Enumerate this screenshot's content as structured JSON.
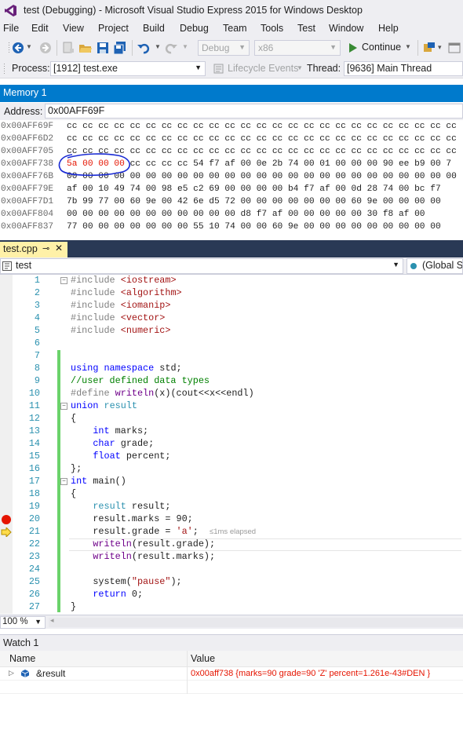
{
  "window": {
    "title": "test (Debugging) - Microsoft Visual Studio Express 2015 for Windows Desktop"
  },
  "menu": [
    "File",
    "Edit",
    "View",
    "Project",
    "Build",
    "Debug",
    "Team",
    "Tools",
    "Test",
    "Window",
    "Help"
  ],
  "toolbar": {
    "config": "Debug",
    "platform": "x86",
    "continue_label": "Continue"
  },
  "toolbar2": {
    "process_label": "Process:",
    "process_value": "[1912] test.exe",
    "lifecycle_label": "Lifecycle Events",
    "thread_label": "Thread:",
    "thread_value": "[9636] Main Thread"
  },
  "memory": {
    "tab_title": "Memory 1",
    "address_label": "Address:",
    "address_value": "0x00AFF69F",
    "rows": [
      {
        "addr": "0x00AFF69F",
        "bytes": "cc cc cc cc cc cc cc cc cc cc cc cc cc cc cc cc cc cc cc cc cc cc cc cc cc"
      },
      {
        "addr": "0x00AFF6D2",
        "bytes": "cc cc cc cc cc cc cc cc cc cc cc cc cc cc cc cc cc cc cc cc cc cc cc cc cc"
      },
      {
        "addr": "0x00AFF705",
        "bytes": "cc cc cc cc cc cc cc cc cc cc cc cc cc cc cc cc cc cc cc cc cc cc cc cc cc"
      },
      {
        "addr": "0x00AFF738",
        "changed": "5a 00 00 00",
        "bytes": " cc cc cc cc 54 f7 af 00 0e 2b 74 00 01 00 00 00 90 ee b9 00 7"
      },
      {
        "addr": "0x00AFF76B",
        "bytes": "00 00 00 00 00 00 00 00 00 00 00 00 00 00 00 00 00 00 00 00 00 00 00 00 00"
      },
      {
        "addr": "0x00AFF79E",
        "bytes": "af 00 10 49 74 00 98 e5 c2 69 00 00 00 00 b4 f7 af 00 0d 28 74 00 bc f7"
      },
      {
        "addr": "0x00AFF7D1",
        "bytes": "7b 99 77 00 60 9e 00 42 6e d5 72 00 00 00 00 00 00 00 60 9e 00 00 00 00"
      },
      {
        "addr": "0x00AFF804",
        "bytes": "00 00 00 00 00 00 00 00 00 00 00 d8 f7 af 00 00 00 00 00 30 f8 af 00"
      },
      {
        "addr": "0x00AFF837",
        "bytes": "77 00 00 00 00 00 00 00 55 10 74 00 00 60 9e 00 00 00 00 00 00 00 00 00"
      }
    ]
  },
  "editor": {
    "tab_name": "test.cpp",
    "project_combo": "test",
    "scope_combo": "(Global Scope)",
    "zoom": "100 %",
    "elapsed_tip": "≤1ms elapsed"
  },
  "watch": {
    "tab_title": "Watch 1",
    "col_name": "Name",
    "col_value": "Value",
    "rows": [
      {
        "name": "&result",
        "value": "0x00aff738 {marks=90 grade=90 'Z' percent=1.261e-43#DEN }"
      }
    ]
  },
  "colors": {
    "accent": "#007acc",
    "tab_active": "#fff1a8",
    "breakpoint": "#e51400",
    "changed_bytes": "#e51400",
    "annotation_circle": "#1a2bd4"
  }
}
